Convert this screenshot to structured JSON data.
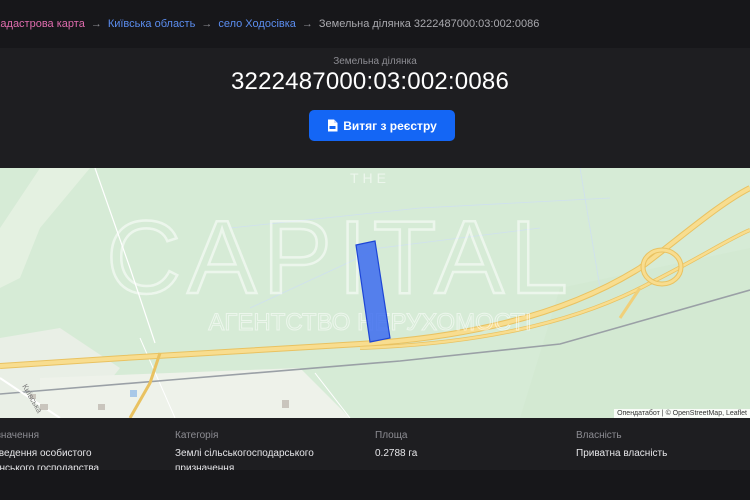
{
  "breadcrumb": {
    "root": "Кадастрова карта",
    "region": "Київська область",
    "village": "село Ходосівка",
    "current": "Земельна ділянка 3222487000:03:002:0086",
    "separator": "→"
  },
  "header": {
    "label": "Земельна ділянка",
    "cadastral_number": "3222487000:03:002:0086",
    "extract_button": "Витяг з реєстру"
  },
  "map": {
    "road_label": "Київська",
    "attribution": "Опендатабот | © OpenStreetMap, Leaflet",
    "watermark_main": "CAPITAL",
    "watermark_top": "THE",
    "watermark_sub": "АГЕНТСТВО НЕРУХОМОСТІ"
  },
  "info": {
    "purpose_label": "Призначення",
    "purpose_value_1": "Для ведення особистого",
    "purpose_value_2": "селянського господарства",
    "category_label": "Категорія",
    "category_value_1": "Землі сільськогосподарського",
    "category_value_2": "призначення",
    "area_label": "Площа",
    "area_value": "0.2788 га",
    "ownership_label": "Власність",
    "ownership_value": "Приватна власність"
  },
  "colors": {
    "accent": "#1466f5",
    "parcel": "#3d6cf0",
    "road": "#f5d27a",
    "map_green": "#d6ebd6"
  }
}
